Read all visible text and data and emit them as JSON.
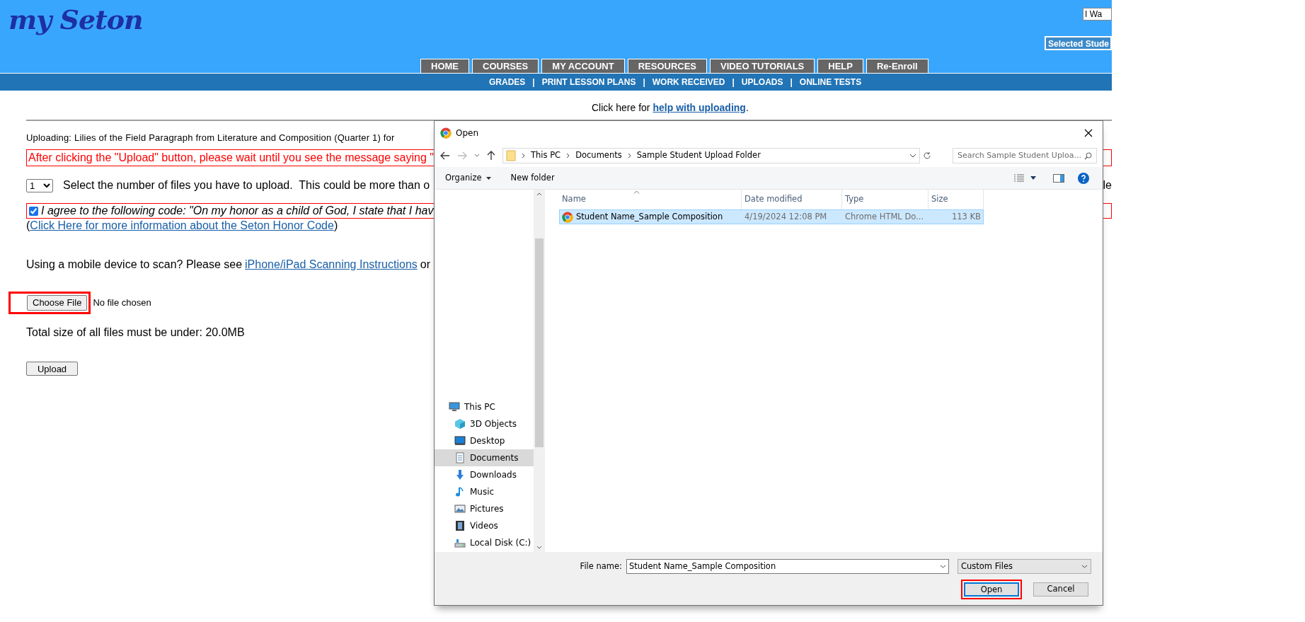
{
  "header": {
    "logo": "my Seton",
    "lookup_value": "I Wa",
    "student_button": "Selected Stude"
  },
  "nav_tabs": [
    "HOME",
    "COURSES",
    "MY ACCOUNT",
    "RESOURCES",
    "VIDEO TUTORIALS",
    "HELP",
    "Re-Enroll"
  ],
  "subnav": [
    "GRADES",
    "|",
    "PRINT LESSON PLANS",
    "|",
    "WORK RECEIVED",
    "|",
    "UPLOADS",
    "|",
    "ONLINE TESTS"
  ],
  "help_line": {
    "prefix": "Click here for",
    "link": "help with uploading",
    "suffix": "."
  },
  "upload": {
    "title": "Uploading: Lilies of the Field Paragraph from Literature and Composition (Quarter 1) for",
    "warning": "After clicking the \"Upload\" button, please wait until you see the message saying \"",
    "file_count": "1",
    "count_label": "Select the number of files you have to upload.  This could be more than o",
    "count_tail": "le",
    "honor": {
      "checked": true,
      "text": "I agree to the following code: \"On my honor as a child of God, I state that I hav",
      "open": "(",
      "link": "Click Here for more information about the Seton Honor Code",
      "close": ")"
    },
    "mobile": {
      "text": "Using a mobile device to scan? Please see",
      "link": "iPhone/iPad Scanning Instructions",
      "suffix": "or"
    },
    "choose_button": "Choose File",
    "choose_highlighted": true,
    "no_file": "No file chosen",
    "size_note": "Total size of all files must be under: 20.0MB",
    "upload_button": "Upload"
  },
  "dialog": {
    "title": "Open",
    "path": [
      "This PC",
      "Documents",
      "Sample Student Upload Folder"
    ],
    "search_placeholder": "Search Sample Student Uploa...",
    "organize": "Organize",
    "new_folder": "New folder",
    "nav": [
      {
        "label": "This PC",
        "kind": "pc",
        "selected": false,
        "children": [
          {
            "label": "3D Objects",
            "kind": "cube",
            "selected": false
          },
          {
            "label": "Desktop",
            "kind": "desktop",
            "selected": false
          },
          {
            "label": "Documents",
            "kind": "documents",
            "selected": true
          },
          {
            "label": "Downloads",
            "kind": "downloads",
            "selected": false
          },
          {
            "label": "Music",
            "kind": "music",
            "selected": false
          },
          {
            "label": "Pictures",
            "kind": "pictures",
            "selected": false
          },
          {
            "label": "Videos",
            "kind": "videos",
            "selected": false
          },
          {
            "label": "Local Disk (C:)",
            "kind": "disk",
            "selected": false
          }
        ]
      }
    ],
    "columns": [
      "Name",
      "Date modified",
      "Type",
      "Size"
    ],
    "files": [
      {
        "name": "Student Name_Sample Composition",
        "date": "4/19/2024 12:08 PM",
        "type": "Chrome HTML Do...",
        "size": "113 KB",
        "selected": true
      }
    ],
    "filename_label": "File name:",
    "filename_value": "Student Name_Sample Composition",
    "filetype": "Custom Files",
    "buttons": [
      {
        "label": "Open",
        "highlighted": true
      },
      {
        "label": "Cancel",
        "highlighted": false
      }
    ]
  }
}
